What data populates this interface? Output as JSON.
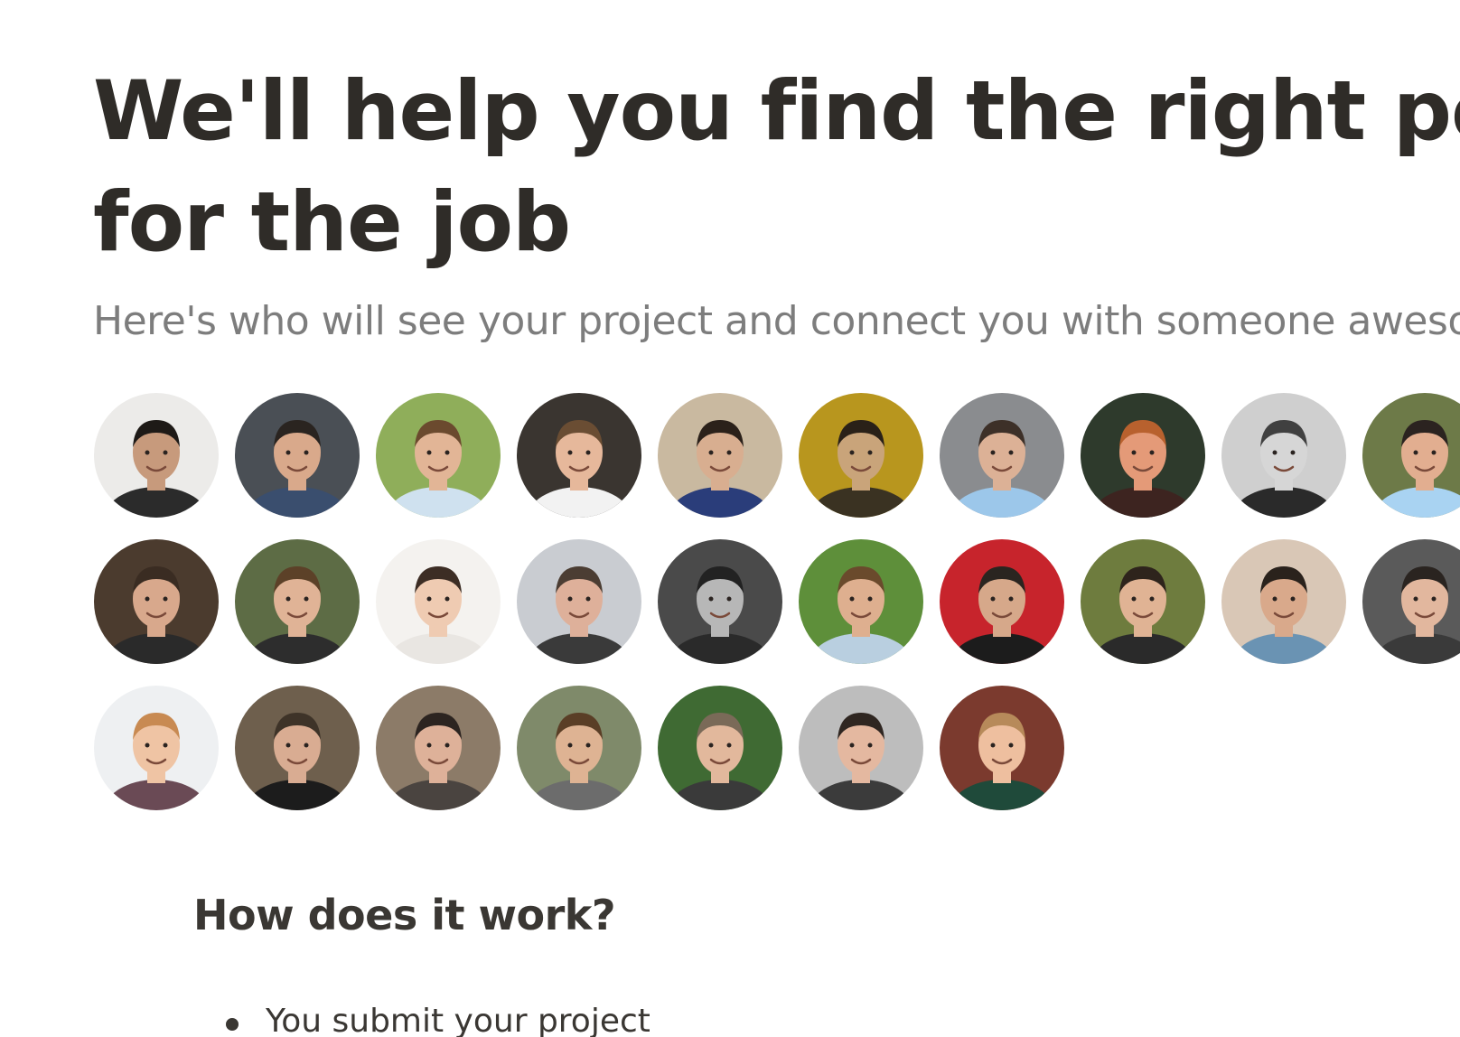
{
  "headline": {
    "line1": "We'll help you find the right person",
    "line2": "for the job"
  },
  "subheadline": "Here's who will see your project and connect you with someone awesome",
  "reviewers": [
    {
      "name": "reviewer-avatar",
      "bg": "#ecebe9",
      "skin": "#c79a7c",
      "hair": "#1e1a17",
      "shirt": "#2b2b2b"
    },
    {
      "name": "reviewer-avatar",
      "bg": "#4a4f55",
      "skin": "#d9a98b",
      "hair": "#2a2420",
      "shirt": "#3a4e6e"
    },
    {
      "name": "reviewer-avatar",
      "bg": "#8fae5a",
      "skin": "#e2b596",
      "hair": "#6b4a2e",
      "shirt": "#cfe1ef"
    },
    {
      "name": "reviewer-avatar",
      "bg": "#3a3530",
      "skin": "#e6b89b",
      "hair": "#6a4d33",
      "shirt": "#f2f2f2"
    },
    {
      "name": "reviewer-avatar",
      "bg": "#c9b9a0",
      "skin": "#d8ae90",
      "hair": "#2b211a",
      "shirt": "#2a3d7a"
    },
    {
      "name": "reviewer-avatar",
      "bg": "#b8961e",
      "skin": "#c9a47a",
      "hair": "#2a2118",
      "shirt": "#3a3222"
    },
    {
      "name": "reviewer-avatar",
      "bg": "#8a8c8f",
      "skin": "#dcb196",
      "hair": "#3d3028",
      "shirt": "#9cc7ea"
    },
    {
      "name": "reviewer-avatar",
      "bg": "#2e3a2c",
      "skin": "#e49a78",
      "hair": "#b8612e",
      "shirt": "#3d2420"
    },
    {
      "name": "reviewer-avatar",
      "bg": "#cfcfcf",
      "skin": "#d6d6d6",
      "hair": "#404040",
      "shirt": "#2a2a2a"
    },
    {
      "name": "reviewer-avatar",
      "bg": "#6d7a48",
      "skin": "#e2ae90",
      "hair": "#2b2320",
      "shirt": "#a9d3f2"
    },
    {
      "name": "reviewer-avatar",
      "bg": "#4b3b2e",
      "skin": "#d8a88c",
      "hair": "#3a2c22",
      "shirt": "#2a2a2a"
    },
    {
      "name": "reviewer-avatar",
      "bg": "#5d6c45",
      "skin": "#e0b396",
      "hair": "#5c4128",
      "shirt": "#2d2d2d"
    },
    {
      "name": "reviewer-avatar",
      "bg": "#f4f2ef",
      "skin": "#efcbb2",
      "hair": "#3c2d24",
      "shirt": "#e9e6e2"
    },
    {
      "name": "reviewer-avatar",
      "bg": "#c9ccd1",
      "skin": "#deb09a",
      "hair": "#4b3d33",
      "shirt": "#3a3a3a"
    },
    {
      "name": "reviewer-avatar",
      "bg": "#4a4a4a",
      "skin": "#b7b7b7",
      "hair": "#222222",
      "shirt": "#2a2a2a"
    },
    {
      "name": "reviewer-avatar",
      "bg": "#5e8f3a",
      "skin": "#deaf8f",
      "hair": "#6a4a2c",
      "shirt": "#b9cfe0"
    },
    {
      "name": "reviewer-avatar",
      "bg": "#c7242c",
      "skin": "#d6a88a",
      "hair": "#2a2520",
      "shirt": "#1c1c1c"
    },
    {
      "name": "reviewer-avatar",
      "bg": "#6e7c3e",
      "skin": "#e0b394",
      "hair": "#2e241c",
      "shirt": "#2a2a2a"
    },
    {
      "name": "reviewer-avatar",
      "bg": "#d9c7b6",
      "skin": "#d9a98b",
      "hair": "#2a221c",
      "shirt": "#6a93b3"
    },
    {
      "name": "reviewer-avatar",
      "bg": "#5a5a5a",
      "skin": "#e2b79e",
      "hair": "#2a2420",
      "shirt": "#3a3a3a"
    },
    {
      "name": "reviewer-avatar",
      "bg": "#eef0f2",
      "skin": "#efc4a4",
      "hair": "#c88a52",
      "shirt": "#6a4a55"
    },
    {
      "name": "reviewer-avatar",
      "bg": "#6e5f4d",
      "skin": "#d9ac92",
      "hair": "#3e3328",
      "shirt": "#1c1c1c"
    },
    {
      "name": "reviewer-avatar",
      "bg": "#8c7b68",
      "skin": "#deb199",
      "hair": "#2c2420",
      "shirt": "#4a4440"
    },
    {
      "name": "reviewer-avatar",
      "bg": "#7f8a6a",
      "skin": "#deb393",
      "hair": "#5a3e26",
      "shirt": "#6c6c6c"
    },
    {
      "name": "reviewer-avatar",
      "bg": "#3f6a33",
      "skin": "#e2b89c",
      "hair": "#7a6a58",
      "shirt": "#3a3a3a"
    },
    {
      "name": "reviewer-avatar",
      "bg": "#bdbdbd",
      "skin": "#e4b8a0",
      "hair": "#2f2621",
      "shirt": "#3b3b3b"
    },
    {
      "name": "reviewer-avatar",
      "bg": "#7b3a2e",
      "skin": "#eebf9f",
      "hair": "#b78a5a",
      "shirt": "#1f4a3a"
    }
  ],
  "how_it_works": {
    "title": "How does it work?",
    "steps": [
      "You submit your project"
    ]
  }
}
